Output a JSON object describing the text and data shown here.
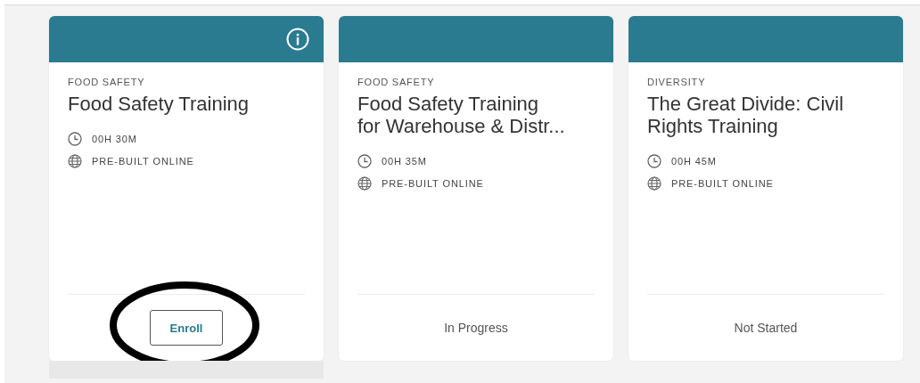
{
  "courses": [
    {
      "category": "FOOD SAFETY",
      "title_lines": [
        "Food Safety Training"
      ],
      "duration": "00H 30M",
      "format": "PRE-BUILT ONLINE",
      "info_icon": true,
      "highlighted": true,
      "footer": {
        "kind": "button",
        "label": "Enroll",
        "circled": true
      }
    },
    {
      "category": "FOOD SAFETY",
      "title_lines": [
        "Food Safety Training",
        "for Warehouse & Distr..."
      ],
      "duration": "00H 35M",
      "format": "PRE-BUILT ONLINE",
      "info_icon": false,
      "highlighted": false,
      "footer": {
        "kind": "status",
        "label": "In Progress",
        "circled": false
      }
    },
    {
      "category": "DIVERSITY",
      "title_lines": [
        "The Great Divide: Civil",
        "Rights Training"
      ],
      "duration": "00H 45M",
      "format": "PRE-BUILT ONLINE",
      "info_icon": false,
      "highlighted": false,
      "footer": {
        "kind": "status",
        "label": "Not Started",
        "circled": false
      }
    }
  ]
}
